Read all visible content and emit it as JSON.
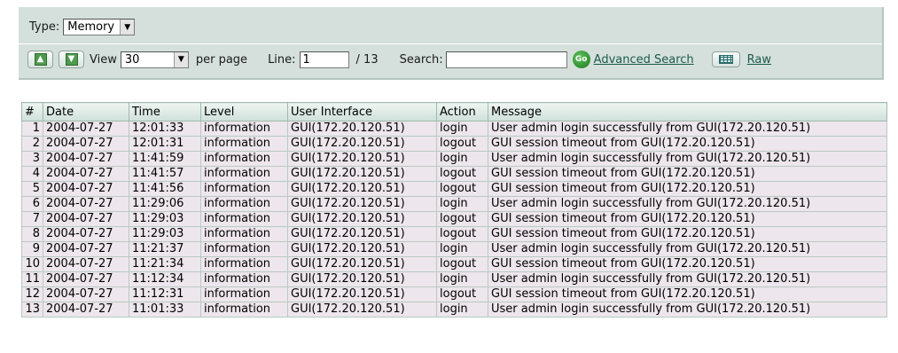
{
  "filter": {
    "type_label": "Type:",
    "type_value": "Memory"
  },
  "toolbar": {
    "view_label": "View",
    "per_page_value": "30",
    "per_page_label": "per page",
    "line_label": "Line:",
    "line_value": "1",
    "line_total": "/ 13",
    "search_label": "Search:",
    "search_value": "",
    "go_label": "Go",
    "advanced_search_label": "Advanced Search",
    "raw_label": "Raw"
  },
  "table": {
    "columns": [
      "#",
      "Date",
      "Time",
      "Level",
      "User Interface",
      "Action",
      "Message"
    ],
    "rows": [
      [
        "1",
        "2004-07-27",
        "12:01:33",
        "information",
        "GUI(172.20.120.51)",
        "login",
        "User admin login successfully from GUI(172.20.120.51)"
      ],
      [
        "2",
        "2004-07-27",
        "12:01:31",
        "information",
        "GUI(172.20.120.51)",
        "logout",
        "GUI session timeout from GUI(172.20.120.51)"
      ],
      [
        "3",
        "2004-07-27",
        "11:41:59",
        "information",
        "GUI(172.20.120.51)",
        "login",
        "User admin login successfully from GUI(172.20.120.51)"
      ],
      [
        "4",
        "2004-07-27",
        "11:41:57",
        "information",
        "GUI(172.20.120.51)",
        "logout",
        "GUI session timeout from GUI(172.20.120.51)"
      ],
      [
        "5",
        "2004-07-27",
        "11:41:56",
        "information",
        "GUI(172.20.120.51)",
        "logout",
        "GUI session timeout from GUI(172.20.120.51)"
      ],
      [
        "6",
        "2004-07-27",
        "11:29:06",
        "information",
        "GUI(172.20.120.51)",
        "login",
        "User admin login successfully from GUI(172.20.120.51)"
      ],
      [
        "7",
        "2004-07-27",
        "11:29:03",
        "information",
        "GUI(172.20.120.51)",
        "logout",
        "GUI session timeout from GUI(172.20.120.51)"
      ],
      [
        "8",
        "2004-07-27",
        "11:29:03",
        "information",
        "GUI(172.20.120.51)",
        "logout",
        "GUI session timeout from GUI(172.20.120.51)"
      ],
      [
        "9",
        "2004-07-27",
        "11:21:37",
        "information",
        "GUI(172.20.120.51)",
        "login",
        "User admin login successfully from GUI(172.20.120.51)"
      ],
      [
        "10",
        "2004-07-27",
        "11:21:34",
        "information",
        "GUI(172.20.120.51)",
        "logout",
        "GUI session timeout from GUI(172.20.120.51)"
      ],
      [
        "11",
        "2004-07-27",
        "11:12:34",
        "information",
        "GUI(172.20.120.51)",
        "login",
        "User admin login successfully from GUI(172.20.120.51)"
      ],
      [
        "12",
        "2004-07-27",
        "11:12:31",
        "information",
        "GUI(172.20.120.51)",
        "logout",
        "GUI session timeout from GUI(172.20.120.51)"
      ],
      [
        "13",
        "2004-07-27",
        "11:01:33",
        "information",
        "GUI(172.20.120.51)",
        "login",
        "User admin login successfully from GUI(172.20.120.51)"
      ]
    ]
  },
  "colors": {
    "panel_bg": "#d5e0dc",
    "row_bg": "#ede6ec",
    "link": "#1b5a4a",
    "go_button": "#2e8b2e"
  },
  "icons": {
    "page_up": "page-up-icon",
    "page_down": "page-down-icon",
    "dropdown": "chevron-down-icon",
    "go": "go-icon",
    "raw": "raw-log-icon"
  }
}
